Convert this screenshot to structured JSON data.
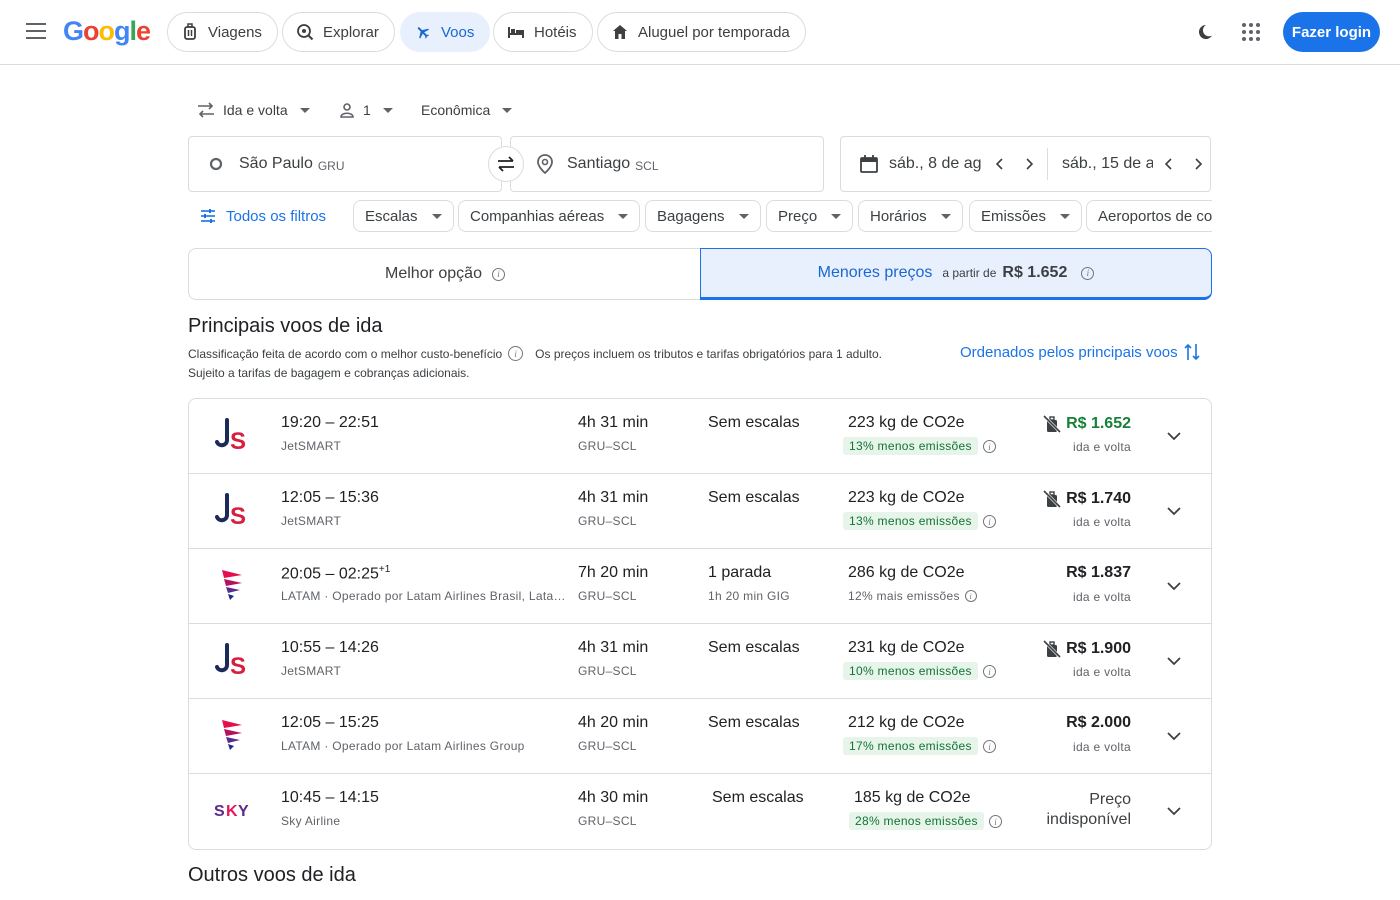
{
  "header": {
    "logo": {
      "l1": "G",
      "l2": "o",
      "l3": "o",
      "l4": "g",
      "l5": "l",
      "l6": "e"
    },
    "nav": [
      {
        "label": "Viagens",
        "icon": "luggage-icon"
      },
      {
        "label": "Explorar",
        "icon": "explore-icon"
      },
      {
        "label": "Voos",
        "icon": "plane-icon"
      },
      {
        "label": "Hotéis",
        "icon": "bed-icon"
      },
      {
        "label": "Aluguel por temporada",
        "icon": "house-icon"
      }
    ],
    "login": "Fazer login"
  },
  "trip": {
    "type": "Ida e volta",
    "passengers": "1",
    "cabin": "Econômica"
  },
  "search": {
    "origin": "São Paulo",
    "origin_code": "GRU",
    "destination": "Santiago",
    "destination_code": "SCL",
    "depart": "sáb., 8 de ag",
    "return": "sáb., 15 de a"
  },
  "filters": {
    "all": "Todos os filtros",
    "chips": [
      "Escalas",
      "Companhias aéreas",
      "Bagagens",
      "Preço",
      "Horários",
      "Emissões",
      "Aeroportos de co"
    ]
  },
  "tabs": {
    "best": "Melhor opção",
    "lowest": "Menores preços",
    "from": "a partir de",
    "from_price": "R$ 1.652"
  },
  "section": {
    "title": "Principais voos de ida",
    "note1": "Classificação feita de acordo com o melhor custo-benefício",
    "note2": "Os preços incluem os tributos e tarifas obrigatórios para 1 adulto.",
    "note3": "Sujeito a tarifas de bagagem e cobranças adicionais.",
    "sort": "Ordenados pelos principais voos"
  },
  "flights": [
    {
      "logo": "jetsmart",
      "times": "19:20 – 22:51",
      "plus": "",
      "airline": "JetSMART",
      "duration": "4h 31 min",
      "route": "GRU–SCL",
      "stops": "Sem escalas",
      "stop_info": "",
      "co2": "223 kg de CO2e",
      "emissions": "13% menos emissões",
      "emis_type": "less",
      "price": "R$ 1.652",
      "price_color": "green",
      "nobag": true,
      "price_type": "ida e volta"
    },
    {
      "logo": "jetsmart",
      "times": "12:05 – 15:36",
      "plus": "",
      "airline": "JetSMART",
      "duration": "4h 31 min",
      "route": "GRU–SCL",
      "stops": "Sem escalas",
      "stop_info": "",
      "co2": "223 kg de CO2e",
      "emissions": "13% menos emissões",
      "emis_type": "less",
      "price": "R$ 1.740",
      "price_color": "normal",
      "nobag": true,
      "price_type": "ida e volta"
    },
    {
      "logo": "latam",
      "times": "20:05 – 02:25",
      "plus": "+1",
      "airline": "LATAM · Operado por Latam Airlines Brasil, Latam Airlines Group",
      "duration": "7h 20 min",
      "route": "GRU–SCL",
      "stops": "1 parada",
      "stop_info": "1h 20 min GIG",
      "co2": "286 kg de CO2e",
      "emissions": "12% mais emissões",
      "emis_type": "more",
      "price": "R$ 1.837",
      "price_color": "normal",
      "nobag": false,
      "price_type": "ida e volta"
    },
    {
      "logo": "jetsmart",
      "times": "10:55 – 14:26",
      "plus": "",
      "airline": "JetSMART",
      "duration": "4h 31 min",
      "route": "GRU–SCL",
      "stops": "Sem escalas",
      "stop_info": "",
      "co2": "231 kg de CO2e",
      "emissions": "10% menos emissões",
      "emis_type": "less",
      "price": "R$ 1.900",
      "price_color": "normal",
      "nobag": true,
      "price_type": "ida e volta"
    },
    {
      "logo": "latam",
      "times": "12:05 – 15:25",
      "plus": "",
      "airline": "LATAM · Operado por Latam Airlines Group",
      "duration": "4h 20 min",
      "route": "GRU–SCL",
      "stops": "Sem escalas",
      "stop_info": "",
      "co2": "212 kg de CO2e",
      "emissions": "17% menos emissões",
      "emis_type": "less",
      "price": "R$ 2.000",
      "price_color": "normal",
      "nobag": false,
      "price_type": "ida e volta"
    },
    {
      "logo": "sky",
      "times": "10:45 – 14:15",
      "plus": "",
      "airline": "Sky Airline",
      "duration": "4h 30 min",
      "route": "GRU–SCL",
      "stops": "Sem escalas",
      "stop_info": "",
      "co2": "185 kg de CO2e",
      "emissions": "28% menos emissões",
      "emis_type": "less",
      "price": "Preço indisponível",
      "price_color": "na",
      "nobag": false,
      "price_type": ""
    }
  ],
  "logos": {
    "jet_j": "J",
    "jet_s": "S",
    "sky_1": "S",
    "sky_2": "K",
    "sky_3": "Y"
  },
  "other": {
    "title": "Outros voos de ida"
  },
  "colors": {
    "accent": "#1a73e8",
    "green": "#188038",
    "border": "#dadce0"
  }
}
